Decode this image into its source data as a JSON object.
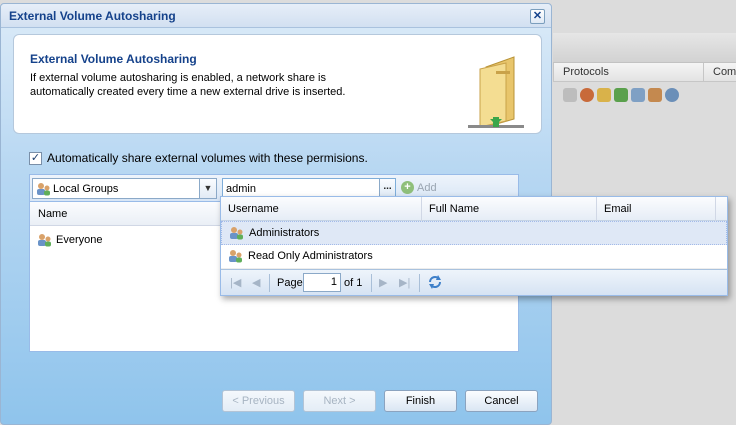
{
  "background": {
    "columns": [
      "Protocols",
      "Comm"
    ]
  },
  "dialog": {
    "title": "External Volume Autosharing",
    "close_label": "✕",
    "info_title": "External Volume Autosharing",
    "info_text": "If external volume autosharing is enabled, a network share is automatically created every time a new external drive is inserted.",
    "checkbox_label": "Automatically share external volumes with these permisions.",
    "checkbox_checked": true,
    "group_select": "Local Groups",
    "search_value": "admin",
    "search_trigger": "...",
    "add_label": "Add",
    "grid_header": "Name",
    "grid_rows": [
      {
        "name": "Everyone"
      }
    ],
    "buttons": {
      "previous": "< Previous",
      "next": "Next >",
      "finish": "Finish",
      "cancel": "Cancel"
    }
  },
  "picker": {
    "columns": [
      "Username",
      "Full Name",
      "Email"
    ],
    "rows": [
      {
        "username": "Administrators",
        "selected": true
      },
      {
        "username": "Read Only Administrators",
        "selected": false
      }
    ],
    "pager": {
      "page_label": "Page",
      "page_value": "1",
      "of_label": "of 1"
    }
  },
  "colors": {
    "title_blue": "#15428b",
    "dialog_gradient_top": "#dcebf8",
    "dialog_gradient_bottom": "#8fc4ec",
    "selection": "#dfe8f6"
  }
}
